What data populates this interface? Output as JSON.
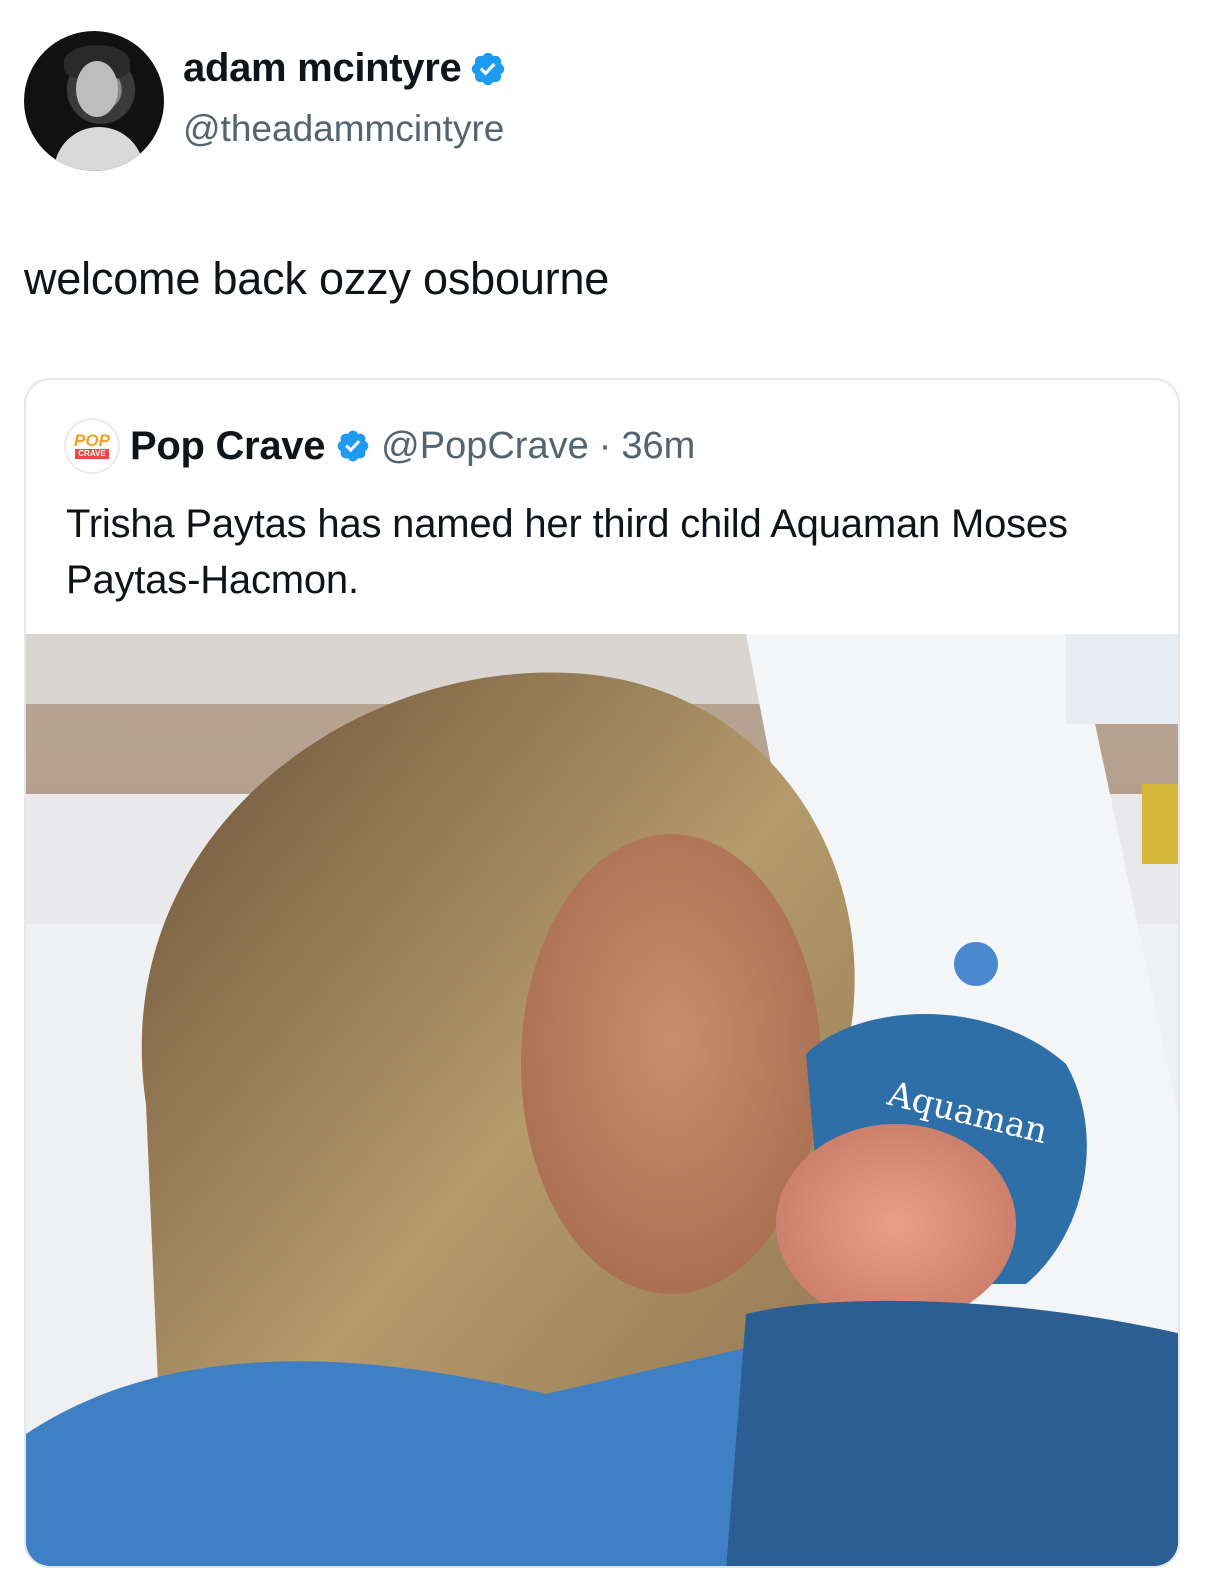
{
  "tweet": {
    "author_name": "adam mcintyre",
    "author_handle": "@theadammcintyre",
    "text": "welcome back ozzy osbourne"
  },
  "quoted_tweet": {
    "author_name": "Pop Crave",
    "author_handle": "@PopCrave",
    "separator": "·",
    "time": "36m",
    "text": "Trisha Paytas has named her third child Aquaman Moses Paytas-Hacmon.",
    "avatar_logo_top": "POP",
    "avatar_logo_bottom": "CRAVE",
    "photo_hat_text": "Aquaman"
  },
  "colors": {
    "verified": "#1d9bf0",
    "text_primary": "#0f1419",
    "text_secondary": "#536471",
    "border": "#e3e7ea"
  },
  "icons": [
    "verified-badge-icon"
  ]
}
